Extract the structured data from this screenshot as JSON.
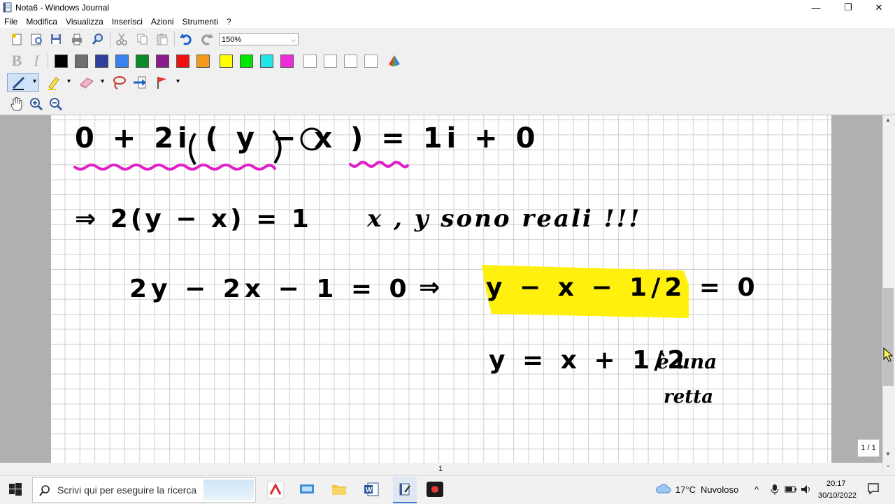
{
  "window": {
    "title": "Nota6 - Windows Journal",
    "minimize_glyph": "—",
    "restore_glyph": "❐",
    "close_glyph": "✕"
  },
  "menu": [
    "File",
    "Modifica",
    "Visualizza",
    "Inserisci",
    "Azioni",
    "Strumenti",
    "?"
  ],
  "toolbar": {
    "zoom_value": "150%",
    "zoom_arrow": "⌵",
    "bold_label": "B",
    "italic_label": "I",
    "filled_colors": [
      "#000000",
      "#6e6e6e",
      "#2f3d9c",
      "#3a82f0",
      "#0a8a2a",
      "#8b1a8b",
      "#f20f0f",
      "#f39a1c",
      "#ffff00",
      "#00e600",
      "#22e6e6",
      "#f02cdc"
    ],
    "empty_color_count": 4,
    "icons": [
      "new-note-icon",
      "new-from-template-icon",
      "save-icon",
      "print-icon",
      "find-icon",
      "cut-icon",
      "copy-icon",
      "paste-icon",
      "undo-icon",
      "redo-icon",
      "color-palette-icon",
      "pen-icon",
      "highlighter-icon",
      "eraser-icon",
      "lasso-icon",
      "insert-space-icon",
      "flag-icon",
      "hand-pan-icon",
      "zoom-in-icon",
      "zoom-out-icon"
    ],
    "dropdown_glyph": "▾"
  },
  "note": {
    "ink": {
      "line1": "0 + 2i ( y − x ) = 1i + 0",
      "line2a": "⇒ 2(y − x) = 1",
      "line2b": "x , y sono reali !!!",
      "line3a": "2y − 2x − 1 = 0",
      "line3b": "⇒",
      "line3c": "y − x − 1/2 = 0",
      "line4": "y = x + 1/2",
      "line4b": "è una",
      "line4c": "retta"
    },
    "highlight_colors": {
      "magenta": "#e020c8",
      "yellow": "#ffef00"
    }
  },
  "page_indicator": "1 / 1",
  "page_number": "1",
  "scrollbar": {
    "up_glyph": "▲",
    "down_glyph": "▼",
    "double_down_glyph": "⌄"
  },
  "taskbar": {
    "start_icon": "windows-start-icon",
    "search_placeholder": "Scrivi qui per eseguire la ricerca",
    "weather_temp": "17°C",
    "weather_text": "Nuvoloso",
    "time": "20:17",
    "date": "30/10/2022",
    "tray_up_glyph": "^"
  }
}
